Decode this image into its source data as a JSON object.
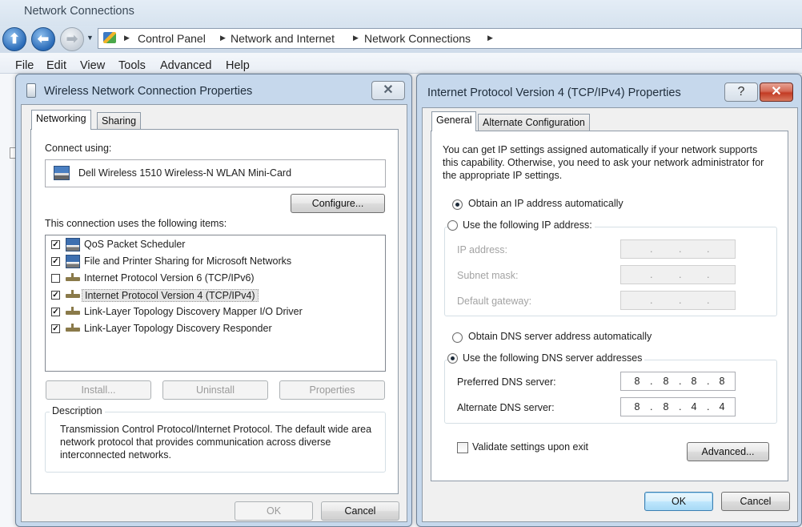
{
  "explorer": {
    "title": "Network Connections",
    "breadcrumbs": [
      "Control Panel",
      "Network and Internet",
      "Network Connections"
    ],
    "menu": [
      "File",
      "Edit",
      "View",
      "Tools",
      "Advanced",
      "Help"
    ]
  },
  "wireless_dialog": {
    "title": "Wireless Network Connection Properties",
    "close_glyph": "✕",
    "tabs": [
      "Networking",
      "Sharing"
    ],
    "connect_using_label": "Connect using:",
    "adapter_name": "Dell Wireless 1510 Wireless-N WLAN Mini-Card",
    "configure_button": "Configure...",
    "items_label": "This connection uses the following items:",
    "items": [
      {
        "label": "QoS Packet Scheduler",
        "checked": true,
        "icon": "network-client-icon"
      },
      {
        "label": "File and Printer Sharing for Microsoft Networks",
        "checked": true,
        "icon": "network-client-icon"
      },
      {
        "label": "Internet Protocol Version 6 (TCP/IPv6)",
        "checked": false,
        "icon": "protocol-icon"
      },
      {
        "label": "Internet Protocol Version 4 (TCP/IPv4)",
        "checked": true,
        "icon": "protocol-icon",
        "selected": true
      },
      {
        "label": "Link-Layer Topology Discovery Mapper I/O Driver",
        "checked": true,
        "icon": "protocol-icon"
      },
      {
        "label": "Link-Layer Topology Discovery Responder",
        "checked": true,
        "icon": "protocol-icon"
      }
    ],
    "install_button": "Install...",
    "uninstall_button": "Uninstall",
    "properties_button": "Properties",
    "description_title": "Description",
    "description_text": "Transmission Control Protocol/Internet Protocol. The default wide area network protocol that provides communication across diverse interconnected networks.",
    "ok_button": "OK",
    "cancel_button": "Cancel"
  },
  "ipv4_dialog": {
    "title": "Internet Protocol Version 4 (TCP/IPv4) Properties",
    "help_glyph": "?",
    "close_glyph": "✕",
    "tabs": [
      "General",
      "Alternate Configuration"
    ],
    "intro_text": "You can get IP settings assigned automatically if your network supports this capability. Otherwise, you need to ask your network administrator for the appropriate IP settings.",
    "obtain_ip_auto": "Obtain an IP address automatically",
    "use_following_ip": "Use the following IP address:",
    "ip_address_label": "IP address:",
    "subnet_mask_label": "Subnet mask:",
    "default_gateway_label": "Default gateway:",
    "obtain_dns_auto": "Obtain DNS server address automatically",
    "use_following_dns": "Use the following DNS server addresses",
    "preferred_dns_label": "Preferred DNS server:",
    "preferred_dns": [
      "8",
      "8",
      "8",
      "8"
    ],
    "alternate_dns_label": "Alternate DNS server:",
    "alternate_dns": [
      "8",
      "8",
      "4",
      "4"
    ],
    "validate_label": "Validate settings upon exit",
    "validate_checked": false,
    "advanced_button": "Advanced...",
    "ok_button": "OK",
    "cancel_button": "Cancel",
    "ip_mode": "automatic",
    "dns_mode": "manual"
  }
}
